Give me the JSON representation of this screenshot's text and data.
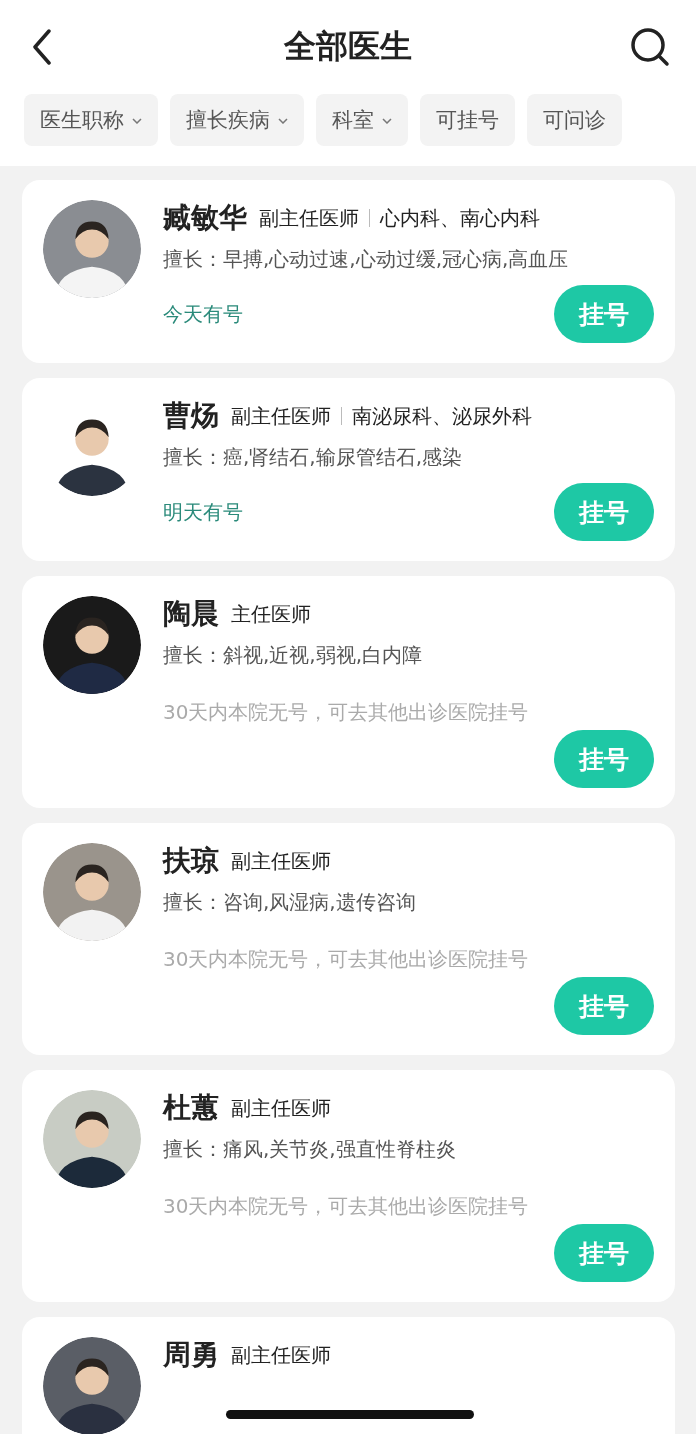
{
  "header": {
    "title": "全部医生"
  },
  "filters": [
    {
      "label": "医生职称",
      "dropdown": true
    },
    {
      "label": "擅长疾病",
      "dropdown": true
    },
    {
      "label": "科室",
      "dropdown": true
    },
    {
      "label": "可挂号",
      "dropdown": false
    },
    {
      "label": "可问诊",
      "dropdown": false
    }
  ],
  "doctors": [
    {
      "name": "臧敏华",
      "title": "副主任医师",
      "department": "心内科、南心内科",
      "expertise": "擅长：早搏,心动过速,心动过缓,冠心病,高血压",
      "availability": {
        "kind": "slots",
        "text": "今天有号"
      },
      "button": "挂号"
    },
    {
      "name": "曹炀",
      "title": "副主任医师",
      "department": "南泌尿科、泌尿外科",
      "expertise": "擅长：癌,肾结石,输尿管结石,感染",
      "availability": {
        "kind": "slots",
        "text": "明天有号"
      },
      "button": "挂号"
    },
    {
      "name": "陶晨",
      "title": "主任医师",
      "expertise": "擅长：斜视,近视,弱视,白内障",
      "availability": {
        "kind": "none",
        "text": "30天内本院无号，可去其他出诊医院挂号"
      },
      "button": "挂号"
    },
    {
      "name": "扶琼",
      "title": "副主任医师",
      "expertise": "擅长：咨询,风湿病,遗传咨询",
      "availability": {
        "kind": "none",
        "text": "30天内本院无号，可去其他出诊医院挂号"
      },
      "button": "挂号"
    },
    {
      "name": "杜蕙",
      "title": "副主任医师",
      "expertise": "擅长：痛风,关节炎,强直性脊柱炎",
      "availability": {
        "kind": "none",
        "text": "30天内本院无号，可去其他出诊医院挂号"
      },
      "button": "挂号"
    },
    {
      "name": "周勇",
      "title": "副主任医师"
    }
  ]
}
